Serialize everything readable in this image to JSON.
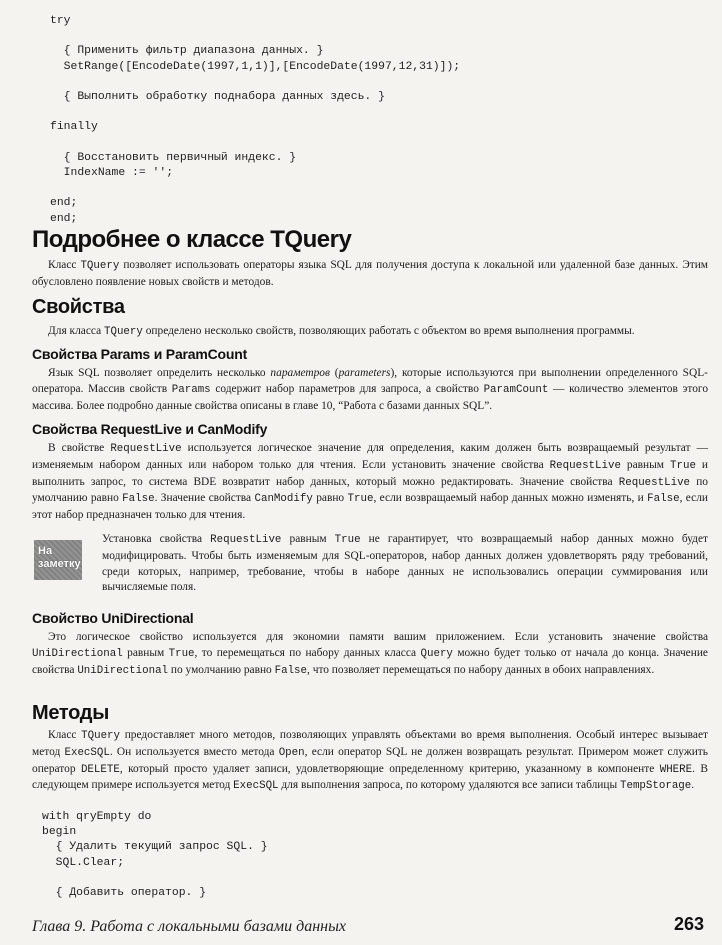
{
  "code_top": [
    "try",
    "",
    "  { Применить фильтр диапазона данных. }",
    "  SetRange([EncodeDate(1997,1,1)],[EncodeDate(1997,12,31)]);",
    "",
    "  { Выполнить обработку поднабора данных здесь. }",
    "",
    "finally",
    "",
    "  { Восстановить первичный индекс. }",
    "  IndexName := '';",
    "",
    "end;",
    "end;"
  ],
  "h1_title": "Подробнее о классе TQuery",
  "p_intro": {
    "a": "Класс ",
    "code1": "TQuery",
    "b": " позволяет использовать операторы языка SQL для получения доступа к локальной или удаленной базе данных. Этим обусловлено появление новых свойств и методов."
  },
  "h2_props": "Свойства",
  "p_props": {
    "a": "Для класса ",
    "code1": "TQuery",
    "b": " определено несколько свойств, позволяющих работать с объектом во время выполнения программы."
  },
  "h3_params": "Свойства Params и ParamCount",
  "p_params": {
    "a": "Язык SQL позволяет определить несколько ",
    "em1": "параметров",
    "b": " (",
    "em2": "parameters",
    "c": "), которые используются при выполнении определенного SQL-оператора. Массив свойств ",
    "code1": "Params",
    "d": " содержит набор параметров для запроса, а свойство ",
    "code2": "ParamCount",
    "e": " — количество элементов этого массива. Более подробно данные свойства описаны в главе 10, “Работа с базами данных SQL”."
  },
  "h3_reqlive": "Свойства RequestLive и CanModify",
  "p_reqlive": {
    "a": "В свойстве ",
    "code1": "RequestLive",
    "b": " используется логическое значение для определения, каким должен быть возвращаемый результат — изменяемым набором данных или набором только для чтения. Если установить значение свойства ",
    "code2": "RequestLive",
    "c": " равным ",
    "code3": "True",
    "d": " и выполнить запрос, то система BDE возвратит набор данных, который можно редактировать. Значение свойства ",
    "code4": "RequestLive",
    "e": " по умолчанию равно ",
    "code5": "False",
    "f": ". Значение свойства ",
    "code6": "CanModify",
    "g": " равно ",
    "code7": "True",
    "h": ", если возвращаемый набор данных можно изменять, и ",
    "code8": "False",
    "i": ", если этот набор предназначен только для чтения."
  },
  "note": {
    "badge_line1": "На",
    "badge_line2": "заметку",
    "a": "Установка свойства ",
    "code1": "RequestLive",
    "b": " равным ",
    "code2": "True",
    "c": " не гарантирует, что возвращаемый набор данных можно будет модифицировать. Чтобы быть изменяемым для SQL-операторов, набор данных должен удовлетворять ряду требований, среди которых, например, требование, чтобы в наборе данных не использовались операции суммирования или вычисляемые поля."
  },
  "h3_unidir": "Свойство UniDirectional",
  "p_unidir": {
    "a": "Это логическое свойство используется для экономии памяти вашим приложением. Если установить значение свойства ",
    "code1": "UniDirectional",
    "b": " равным ",
    "code2": "True",
    "c": ", то перемещаться по набору данных класса ",
    "code3": "Query",
    "d": " можно будет только от начала до конца. Значение свойства ",
    "code4": "UniDirectional",
    "e": " по умолчанию равно ",
    "code5": "False",
    "f": ", что позволяет перемещаться по набору данных в обоих направлениях."
  },
  "h2_methods": "Методы",
  "p_methods": {
    "a": "Класс ",
    "code1": "TQuery",
    "b": " предоставляет много методов, позволяющих управлять объектами во время выполнения. Особый интерес вызывает метод ",
    "code2": "ExecSQL",
    "c": ". Он используется вместо метода ",
    "code3": "Open",
    "d": ", если оператор SQL не должен возвращать результат. Примером может служить оператор ",
    "code4": "DELETE",
    "e": ", который просто удаляет записи, удовлетворяющие определенному критерию, указанному в компоненте ",
    "code5": "WHERE",
    "f": ". В следующем примере используется метод ",
    "code6": "ExecSQL",
    "g": " для выполнения запроса, по которому удаляются все записи таблицы ",
    "code7": "TempStorage",
    "h": "."
  },
  "code_bottom": [
    "with qryEmpty do",
    "begin",
    "  { Удалить текущий запрос SQL. }",
    "  SQL.Clear;",
    "",
    "  { Добавить оператор. }"
  ],
  "footer": {
    "chapter": "Глава 9. Работа с локальными базами данных",
    "page": "263"
  }
}
